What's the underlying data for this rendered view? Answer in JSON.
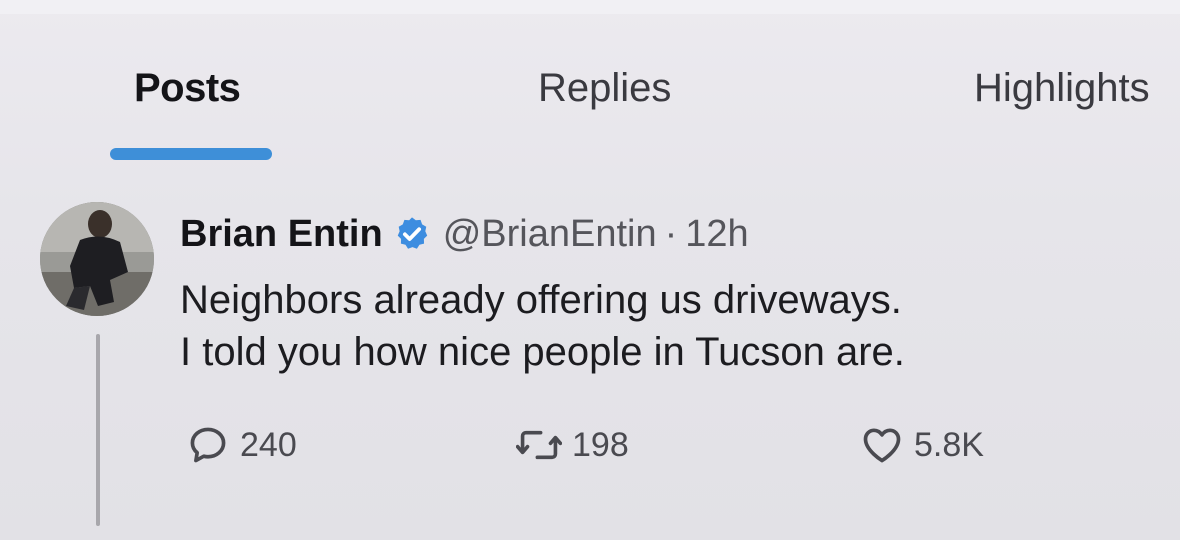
{
  "tabs": [
    {
      "label": "Posts",
      "active": true
    },
    {
      "label": "Replies",
      "active": false
    },
    {
      "label": "Highlights",
      "active": false
    }
  ],
  "colors": {
    "accent": "#3e8fd8",
    "verified": "#3d8de0",
    "background": "#e7e6e9"
  },
  "post": {
    "display_name": "Brian Entin",
    "verified": true,
    "handle": "@BrianEntin",
    "separator": "·",
    "time": "12h",
    "text_lines": [
      "Neighbors already offering us driveways.",
      "I told you how nice people in Tucson are."
    ],
    "actions": {
      "reply": {
        "icon": "comment-bubble-icon",
        "count": "240"
      },
      "repost": {
        "icon": "repost-arrows-icon",
        "count": "198"
      },
      "like": {
        "icon": "heart-icon",
        "count": "5.8K"
      }
    }
  }
}
